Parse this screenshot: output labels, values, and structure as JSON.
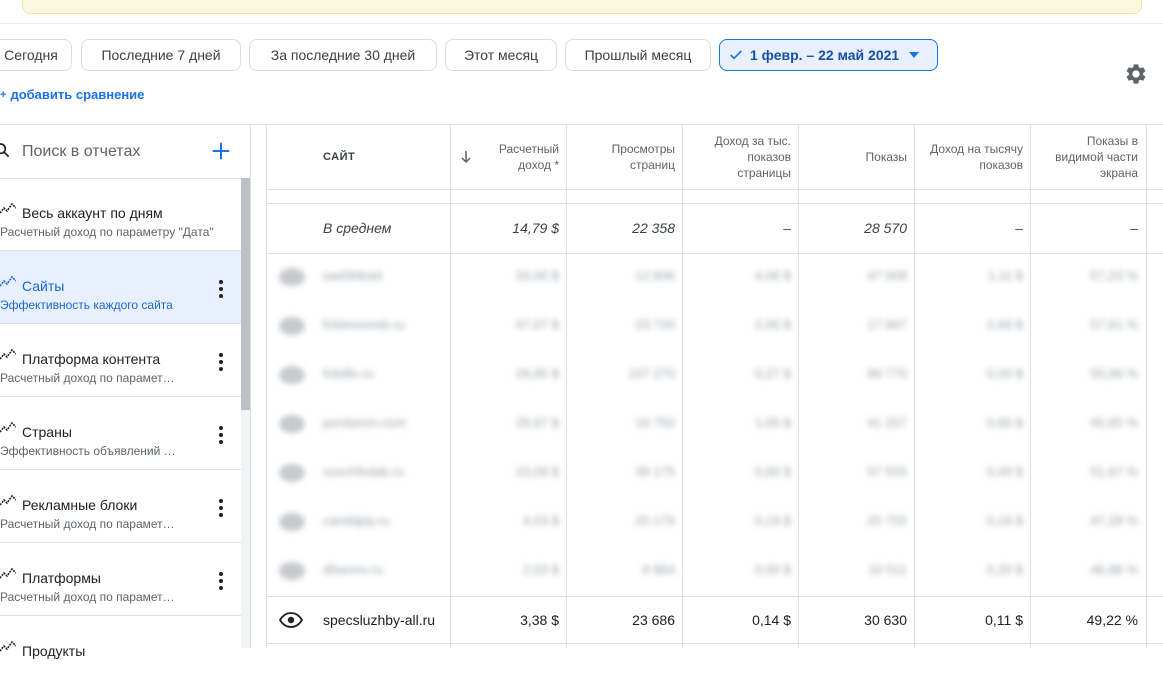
{
  "date_chips": [
    {
      "label": "Сегодня"
    },
    {
      "label": "Последние 7 дней"
    },
    {
      "label": "За последние 30 дней"
    },
    {
      "label": "Этот месяц"
    },
    {
      "label": "Прошлый месяц"
    }
  ],
  "selected_range": "1 февр. – 22 май 2021",
  "add_comparison": "добавить сравнение",
  "sidebar": {
    "search_placeholder": "Поиск в отчетах",
    "items": [
      {
        "title": "Весь аккаунт по дням",
        "subtitle": "Расчетный доход по параметру \"Дата\""
      },
      {
        "title": "Сайты",
        "subtitle": "Эффективность каждого сайта"
      },
      {
        "title": "Платформа контента",
        "subtitle": "Расчетный доход по парамет…"
      },
      {
        "title": "Страны",
        "subtitle": "Эффективность объявлений …"
      },
      {
        "title": "Рекламные блоки",
        "subtitle": "Расчетный доход по парамет…"
      },
      {
        "title": "Платформы",
        "subtitle": "Расчетный доход по парамет…"
      },
      {
        "title": "Продукты",
        "subtitle": ""
      }
    ]
  },
  "table": {
    "headers": {
      "site": "САЙТ",
      "revenue": "Расчетный доход *",
      "pageviews": "Просмотры страниц",
      "page_rpm": "Доход за тыс. показов страницы",
      "impressions": "Показы",
      "rpm": "Доход на тысячу показов",
      "viewability": "Показы в видимой части экрана"
    },
    "average": {
      "label": "В среднем",
      "revenue": "14,79 $",
      "pageviews": "22 358",
      "page_rpm": "–",
      "impressions": "28 570",
      "rpm": "–",
      "viewability": "–"
    },
    "blurred_rows": [
      {
        "site": "sad3hlinet",
        "revenue": "33,00 $",
        "pageviews": "12 806",
        "page_rpm": "4,06 $",
        "impressions": "47 008",
        "rpm": "1,11 $",
        "viewability": "57,23 %"
      },
      {
        "site": "fckbnoonsb.ru",
        "revenue": "47,07 $",
        "pageviews": "23 720",
        "page_rpm": "2,00 $",
        "impressions": "17 667",
        "rpm": "2,69 $",
        "viewability": "57,61 %"
      },
      {
        "site": "fcbdfo.ru",
        "revenue": "29,65 $",
        "pageviews": "107 270",
        "page_rpm": "0,27 $",
        "impressions": "89 770",
        "rpm": "0,33 $",
        "viewability": "55,06 %"
      },
      {
        "site": "pordamm.com",
        "revenue": "29,67 $",
        "pageviews": "16 750",
        "page_rpm": "1,00 $",
        "impressions": "41 207",
        "rpm": "0,60 $",
        "viewability": "45,65 %"
      },
      {
        "site": "sovchfsdab.ru",
        "revenue": "23,09 $",
        "pageviews": "38 175",
        "page_rpm": "0,60 $",
        "impressions": "57 555",
        "rpm": "0,40 $",
        "viewability": "51,67 %"
      },
      {
        "site": "canddpiy.ru",
        "revenue": "4,03 $",
        "pageviews": "20 176",
        "page_rpm": "0,19 $",
        "impressions": "20 755",
        "rpm": "0,16 $",
        "viewability": "47,28 %"
      },
      {
        "site": "dfsennv.ru",
        "revenue": "2,03 $",
        "pageviews": "9 864",
        "page_rpm": "0,00 $",
        "impressions": "10 511",
        "rpm": "0,20 $",
        "viewability": "46,88 %"
      }
    ],
    "visible_row": {
      "site": "specsluzhby-all.ru",
      "revenue": "3,38 $",
      "pageviews": "23 686",
      "page_rpm": "0,14 $",
      "impressions": "30 630",
      "rpm": "0,11 $",
      "viewability": "49,22 %"
    }
  }
}
